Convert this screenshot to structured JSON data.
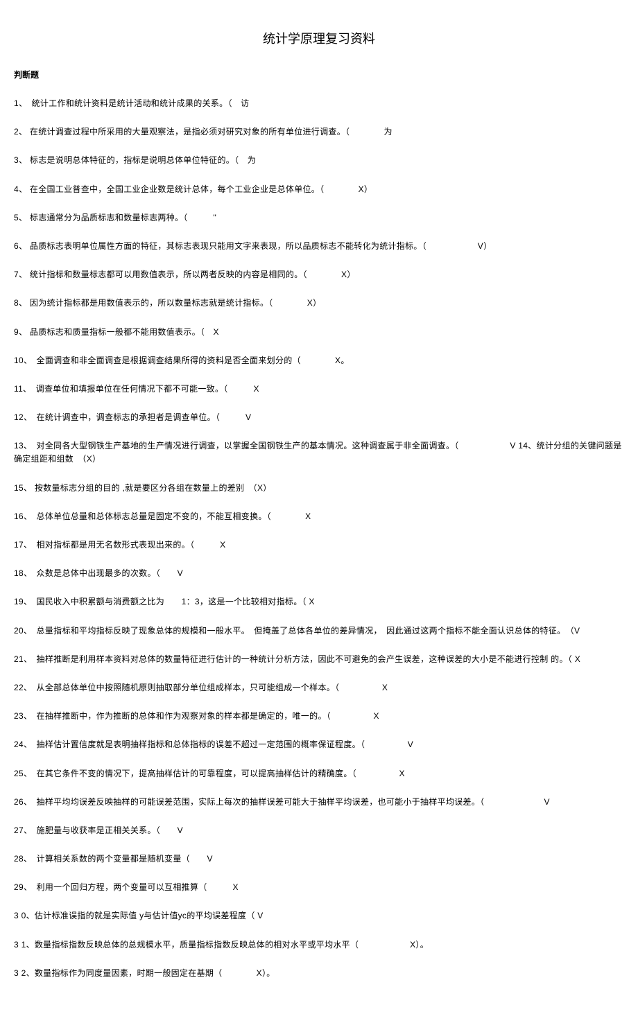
{
  "title": "统计学原理复习资料",
  "sectionHeader": "判断题",
  "questions": [
    "1、　统计工作和统计资料是统计活动和统计成果的关系。（　访",
    "2、 在统计调查过程中所采用的大量观察法，是指必须对研究对象的所有单位进行调查。（　　　　为",
    "3、 标志是说明总体特征的，指标是说明总体单位特征的。（　为",
    "4、 在全国工业普查中，全国工业企业数是统计总体，每个工业企业是总体单位。（　　　　X）",
    "5、 标志通常分为品质标志和数量标志两种。（　　　\"",
    "6、 品质标志表明单位属性方面的特征，其标志表现只能用文字来表现，所以品质标志不能转化为统计指标。（　　　　　　V）",
    "7、 统计指标和数量标志都可以用数值表示，所以两者反映的内容是相同的。（　　　　X）",
    "8、 因为统计指标都是用数值表示的，所以数量标志就是统计指标。（　　　　X）",
    "9、 品质标志和质量指标一般都不能用数值表示。（　X",
    "10、　全面调查和非全面调查是根据调查结果所得的资料是否全面来划分的（　　　　X。",
    "11、　调查单位和填报单位在任何情况下都不可能一致。（　　　X",
    "12、　在统计调查中，调查标志的承担者是调查单位。（　　　V",
    "13、　对全同各大型钢铁生产基地的生产情况进行调查，以掌握全国钢铁生产的基本情况。这种调查属于非全面调查。（　　　　　　V 14、统计分组的关键问题是确定组距和组数　（X）",
    "15、 按数量标志分组的目的 ,就是要区分各组在数量上的差别　（X）",
    "16、　总体单位总量和总体标志总量是固定不变的，不能互相变换。（　　　　X",
    "17、　相对指标都是用无名数形式表现出来的。（　　　X",
    "18、　众数是总体中出现最多的次数。（　　V",
    "19、　国民收入中积累额与消费额之比为　　1：3，这是一个比较相对指标。（ X",
    "20、　总量指标和平均指标反映了现象总体的规模和一般水平。　但掩盖了总体各单位的差异情况，　因此通过这两个指标不能全面认识总体的特征。　（V",
    "21、　抽样推断是利用样本资料对总体的数量特征进行估计的一种统计分析方法，因此不可避免的会产生误差，这种误差的大小是不能进行控制 的。（ X",
    "22、　从全部总体单位中按照随机原则抽取部分单位组成样本，只可能组成一个样本。（　　　　　X",
    "23、　在抽样推断中，作为推断的总体和作为观察对象的样本都是确定的，唯一的。（　　　　　X",
    "24、　抽样估计置信度就是表明抽样指标和总体指标的误差不超过一定范围的概率保证程度。（　　　　　V",
    "25、　在其它条件不变的情况下，提高抽样估计的可靠程度，可以提高抽样估计的精确度。（　　　　　X",
    "26、　抽样平均均误差反映抽样的可能误差范围，实际上每次的抽样误差可能大于抽样平均误差，也可能小于抽样平均误差。（　　　　　　　V",
    "27、　施肥量与收获率是正相关关系。（　　V",
    "28、　计算相关系数的两个变量都是随机变量（　　V",
    "29、　利用一个回归方程，两个变量可以互相推算（　　　X",
    "3 0、估计标准误指的就是实际值 y与估计值yc的平均误差程度（ V",
    "3 1、数量指标指数反映总体的总规模水平，质量指标指数反映总体的相对水平或平均水平（　　　　　　X）。",
    "3 2、数量指标作为同度量因素，时期一般固定在基期（　　　　X）。"
  ]
}
